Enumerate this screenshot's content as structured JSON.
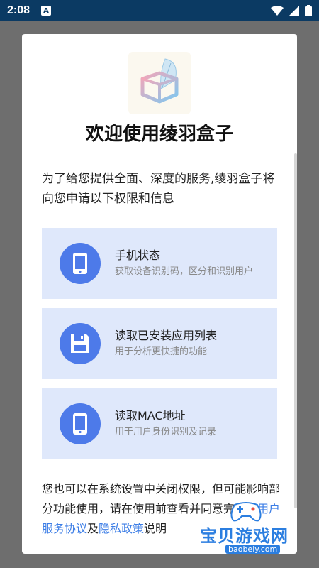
{
  "status_bar": {
    "time": "2:08",
    "app_icon_letter": "A"
  },
  "dialog": {
    "title": "欢迎使用绫羽盒子",
    "intro": "为了给您提供全面、深度的服务,绫羽盒子将向您申请以下权限和信息",
    "permissions": [
      {
        "icon": "phone-icon",
        "title": "手机状态",
        "desc": "获取设备识别码，区分和识别用户"
      },
      {
        "icon": "save-disk-icon",
        "title": "读取已安装应用列表",
        "desc": "用于分析更快捷的功能"
      },
      {
        "icon": "phone-icon",
        "title": "读取MAC地址",
        "desc": "用于用户身份识别及记录"
      }
    ],
    "footer": {
      "text_before": "您也可以在系统设置中关闭权限，但可能影响部分功能使用，请在使用前查看并同意完整的",
      "user_agreement": "用户服务协议",
      "and": "及",
      "privacy_policy": "隐私政策",
      "text_after": "说明"
    }
  },
  "watermark": {
    "text": "宝贝游戏网",
    "url": "baobeiy.com"
  },
  "colors": {
    "status_bar": "#0b3a63",
    "accent": "#4d7ae9",
    "card_bg": "#dfe8fb",
    "link": "#3d7ee6"
  }
}
